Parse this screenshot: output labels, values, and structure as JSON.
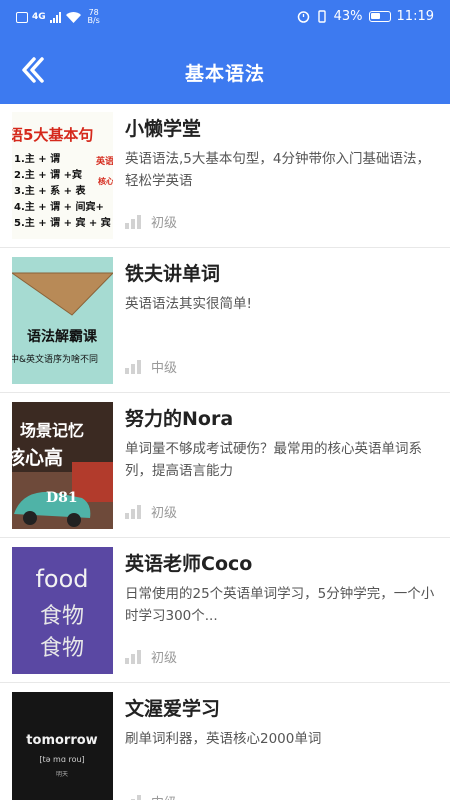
{
  "status_bar": {
    "network": "4G",
    "speed": "78\nB/s",
    "battery": "43%",
    "time": "11:19"
  },
  "header": {
    "title": "基本语法",
    "back_icon": "chevron-left-icon"
  },
  "courses": [
    {
      "name": "小懒学堂",
      "desc": "英语语法,5大基本句型，4分钟带你入门基础语法，轻松学英语",
      "level": "初级",
      "thumb": {
        "title": "语5大基本句",
        "lines": [
          "1.主 + 谓",
          "2.主 + 谓 +宾",
          "3.主 + 系 + 表",
          "4.主 + 谓 + 间宾+",
          "5.主 + 谓 + 宾 + 宾"
        ],
        "side": "英语",
        "side2": "核心"
      }
    },
    {
      "name": "铁夫讲单词",
      "desc": "英语语法其实很简单!",
      "level": "中级",
      "thumb": {
        "title": "语法解霸课",
        "sub": "中&英文语序为啥不同"
      }
    },
    {
      "name": "努力的Nora",
      "desc": "单词量不够成考试硬伤？最常用的核心英语单词系列，提高语言能力",
      "level": "初级",
      "thumb": {
        "title": "场景记忆",
        "sub": "核心高",
        "tag": "D81"
      }
    },
    {
      "name": "英语老师Coco",
      "desc": "日常使用的25个英语单词学习，5分钟学完，一个小时学习300个...",
      "level": "初级",
      "thumb": {
        "title": "food",
        "sub": "食物",
        "sub2": "食物"
      }
    },
    {
      "name": "文渥爱学习",
      "desc": "刷单词利器，英语核心2000单词",
      "level": "中级",
      "thumb": {
        "title": "tomorrow",
        "sub": "[tə mɑ rou]",
        "sub2": "明天"
      }
    }
  ],
  "colors": {
    "primary": "#3d7af0",
    "text_dark": "#222222",
    "text_muted": "#9a9a9a"
  }
}
